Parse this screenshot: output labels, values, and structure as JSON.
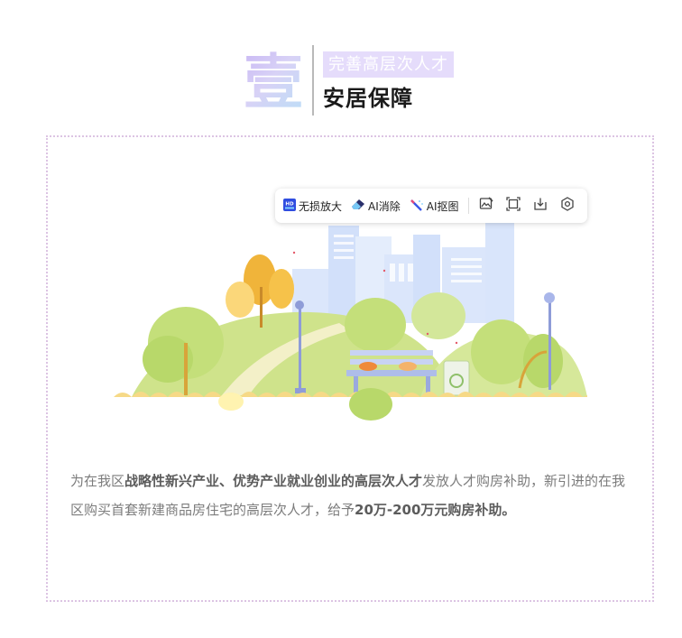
{
  "header": {
    "number_glyph": "壹",
    "subtitle": "完善高层次人才",
    "title": "安居保障"
  },
  "toolbar": {
    "upscale_label": "无损放大",
    "erase_label": "AI消除",
    "cutout_label": "AI抠图",
    "upscale_badge": "HD",
    "icons": [
      "image-edit-icon",
      "crop-frame-icon",
      "download-icon",
      "settings-icon"
    ]
  },
  "paragraph": {
    "segments": [
      {
        "text": "为在我区",
        "bold": false
      },
      {
        "text": "战略性新兴产业、优势产业就业创业的高层次人才",
        "bold": true
      },
      {
        "text": "发放人才购房补助，新引进的在我区购买首套新建商品房住宅的高层次人才，给予",
        "bold": false
      },
      {
        "text": "20万-200万元购房补助。",
        "bold": true
      }
    ]
  },
  "colors": {
    "accent_lavender": "#e5dcfb",
    "frame_border": "#dcc4e3",
    "body_text": "#7c7c7c",
    "bold_text": "#5c5c5c"
  }
}
